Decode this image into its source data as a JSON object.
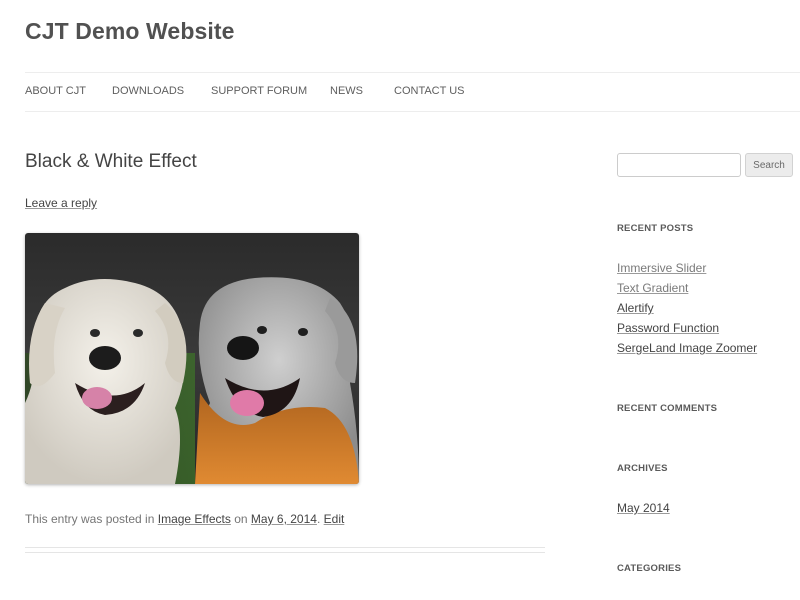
{
  "site": {
    "title": "CJT Demo Website"
  },
  "nav": {
    "items": [
      {
        "label": "ABOUT CJT"
      },
      {
        "label": "DOWNLOADS"
      },
      {
        "label": "SUPPORT FORUM"
      },
      {
        "label": "NEWS"
      },
      {
        "label": "CONTACT US"
      }
    ]
  },
  "post": {
    "title": "Black & White Effect",
    "reply_link": "Leave a reply",
    "image_alt": "two golden retrievers",
    "meta": {
      "prefix": "This entry was posted in ",
      "category": "Image Effects",
      "on": " on ",
      "date": "May 6, 2014",
      "period": ".",
      "edit": "Edit"
    }
  },
  "sidebar": {
    "search": {
      "value": "",
      "button_label": "Search"
    },
    "recent_posts": {
      "title": "RECENT POSTS",
      "items": [
        {
          "label": "Immersive Slider"
        },
        {
          "label": "Text Gradient"
        },
        {
          "label": "Alertify"
        },
        {
          "label": "Password Function"
        },
        {
          "label": "SergeLand Image Zoomer"
        }
      ]
    },
    "recent_comments": {
      "title": "RECENT COMMENTS"
    },
    "archives": {
      "title": "ARCHIVES",
      "items": [
        {
          "label": "May 2014"
        }
      ]
    },
    "categories": {
      "title": "CATEGORIES"
    }
  }
}
